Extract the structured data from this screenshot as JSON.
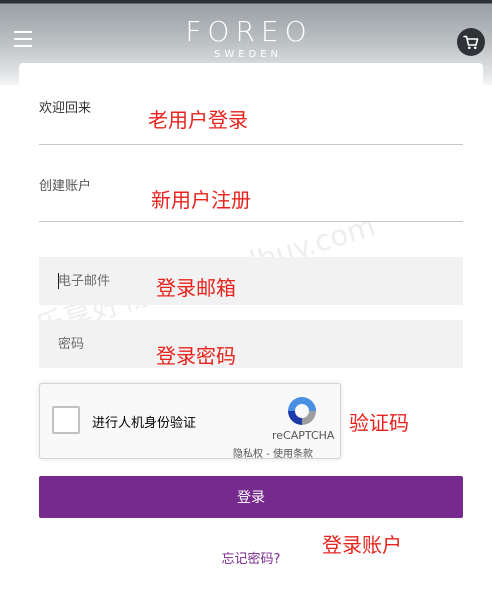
{
  "header": {
    "brand": "FOREO",
    "brand_sub": "SWEDEN",
    "menu_icon": "hamburger-menu-icon",
    "cart_icon": "shopping-cart-icon"
  },
  "tabs": {
    "welcome_back": "欢迎回来",
    "create_account": "创建账户"
  },
  "form": {
    "email_placeholder": "电子邮件",
    "password_placeholder": "密码",
    "login_button": "登录",
    "forgot_password": "忘记密码?"
  },
  "recaptcha": {
    "label": "进行人机身份验证",
    "brand": "reCAPTCHA",
    "privacy": "隐私权",
    "separator": " - ",
    "terms": "使用条款"
  },
  "annotations": {
    "old_user_login": "老用户登录",
    "new_user_register": "新用户注册",
    "login_email": "登录邮箱",
    "login_password": "登录密码",
    "captcha": "验证码",
    "login_account": "登录账户"
  },
  "watermark": "乐享好物 cngoodbuy.com",
  "colors": {
    "accent": "#772a8e",
    "annotation": "#e8231d",
    "field_bg": "#f2f2f2"
  }
}
